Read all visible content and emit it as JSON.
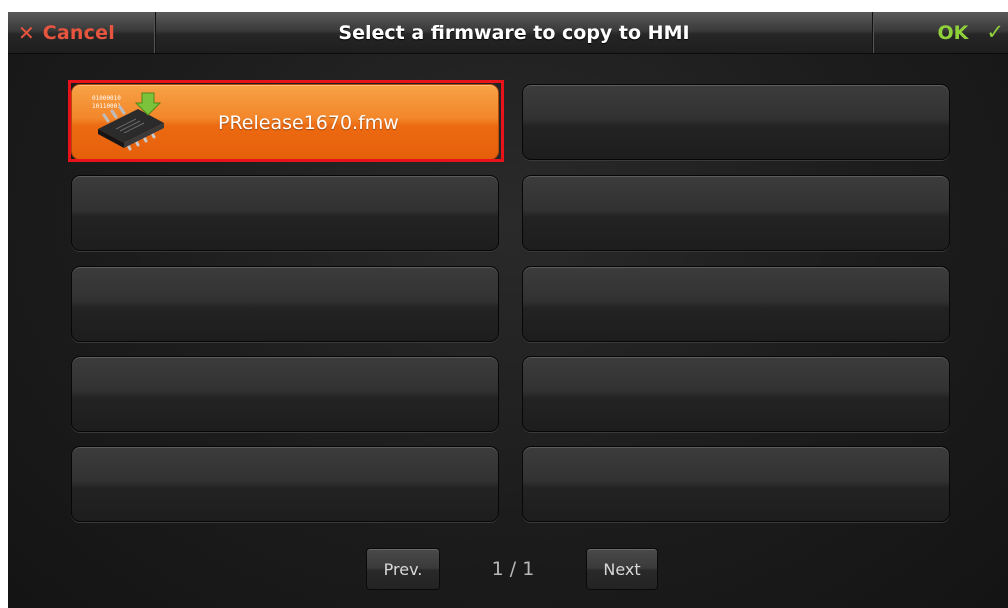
{
  "header": {
    "cancel_icon": "x-icon",
    "cancel_label": "Cancel",
    "title": "Select a firmware to copy to HMI",
    "ok_label": "OK",
    "ok_icon": "checkmark-icon"
  },
  "files": [
    {
      "name": "PRelease1670.fmw",
      "icon": "firmware-chip-icon",
      "selected": true
    },
    {
      "name": "",
      "selected": false
    },
    {
      "name": "",
      "selected": false
    },
    {
      "name": "",
      "selected": false
    },
    {
      "name": "",
      "selected": false
    },
    {
      "name": "",
      "selected": false
    },
    {
      "name": "",
      "selected": false
    },
    {
      "name": "",
      "selected": false
    },
    {
      "name": "",
      "selected": false
    },
    {
      "name": "",
      "selected": false
    }
  ],
  "chip_binary_text": [
    "01000010",
    "10110001"
  ],
  "pagination": {
    "prev_label": "Prev.",
    "page_indicator": "1 / 1",
    "next_label": "Next"
  },
  "colors": {
    "cancel": "#e8553e",
    "ok": "#8fd13a",
    "selected_tile": "#f3862a",
    "selection_border": "#e8121a"
  }
}
